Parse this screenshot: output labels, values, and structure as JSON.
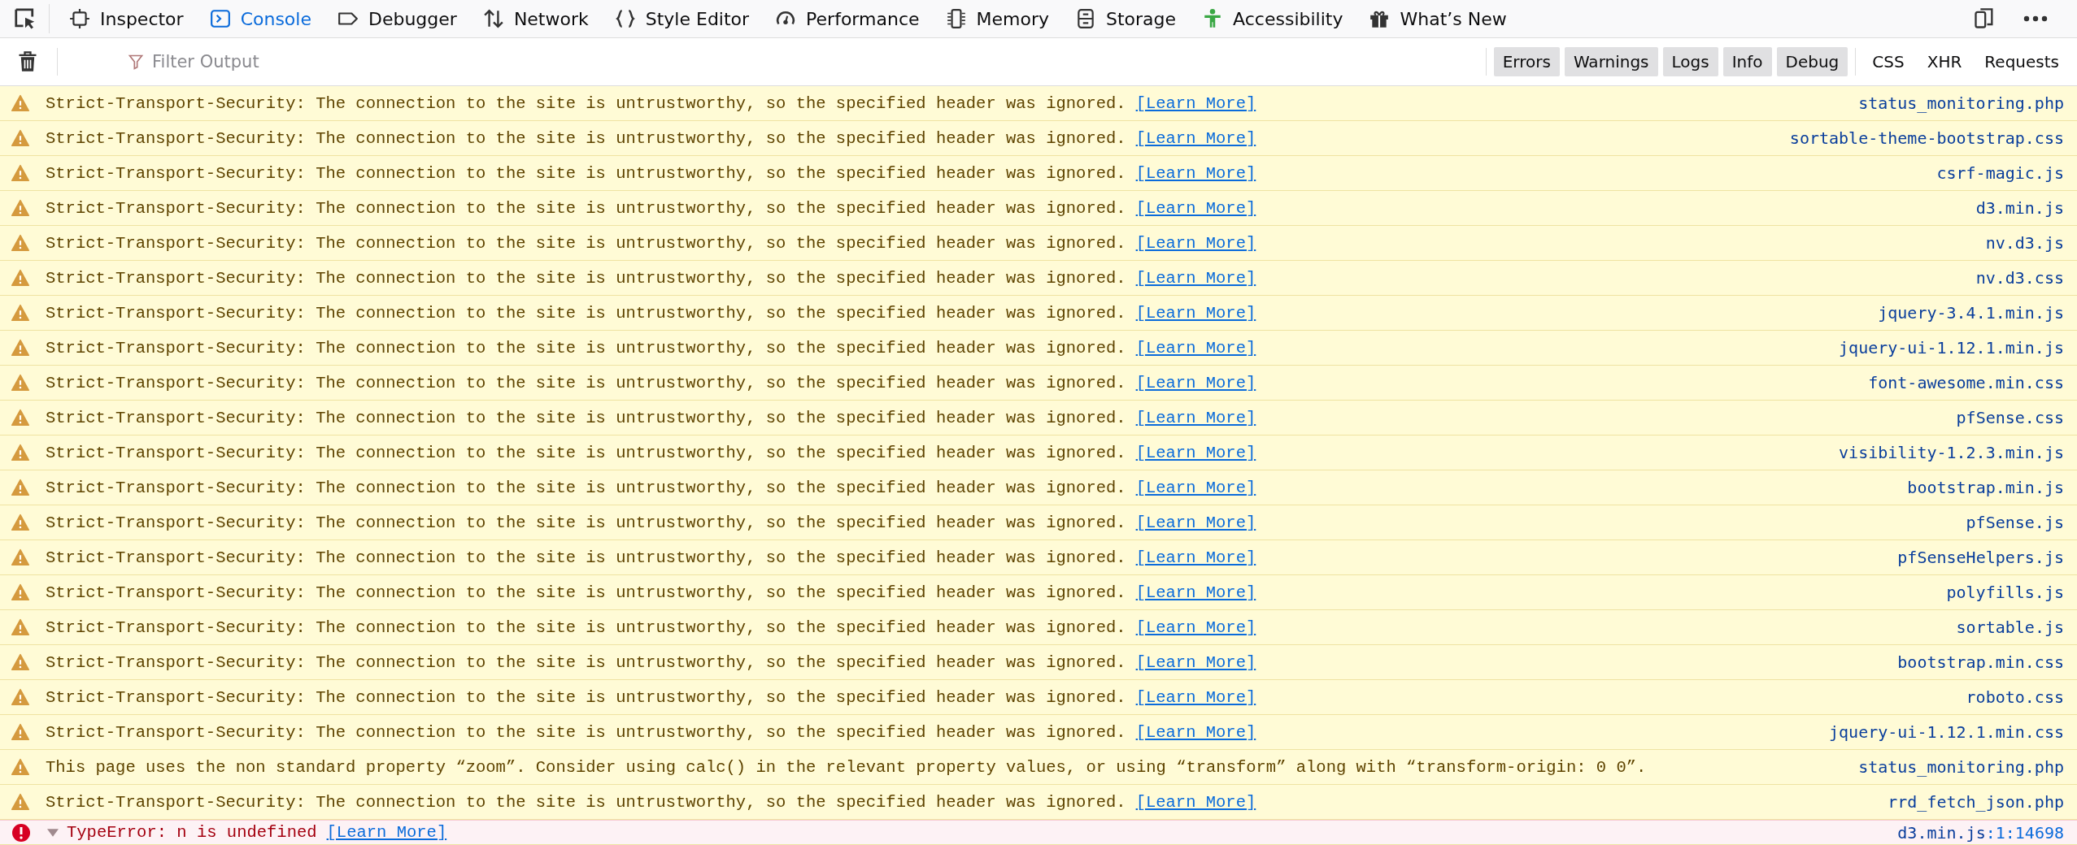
{
  "toolbar": {
    "tabs": [
      {
        "label": "Inspector",
        "selected": false
      },
      {
        "label": "Console",
        "selected": true
      },
      {
        "label": "Debugger",
        "selected": false
      },
      {
        "label": "Network",
        "selected": false
      },
      {
        "label": "Style Editor",
        "selected": false
      },
      {
        "label": "Performance",
        "selected": false
      },
      {
        "label": "Memory",
        "selected": false
      },
      {
        "label": "Storage",
        "selected": false
      },
      {
        "label": "Accessibility",
        "selected": false
      },
      {
        "label": "What’s New",
        "selected": false
      }
    ]
  },
  "filter_bar": {
    "placeholder": "Filter Output",
    "level_filters": [
      {
        "label": "Errors",
        "selected": true
      },
      {
        "label": "Warnings",
        "selected": true
      },
      {
        "label": "Logs",
        "selected": true
      },
      {
        "label": "Info",
        "selected": true
      },
      {
        "label": "Debug",
        "selected": true
      }
    ],
    "type_filters": [
      {
        "label": "CSS",
        "selected": false
      },
      {
        "label": "XHR",
        "selected": false
      },
      {
        "label": "Requests",
        "selected": false
      }
    ]
  },
  "messages": [
    {
      "kind": "warning",
      "text": "Strict-Transport-Security: The connection to the site is untrustworthy, so the specified header was ignored.",
      "link": "[Learn More]",
      "source": "status_monitoring.php"
    },
    {
      "kind": "warning",
      "text": "Strict-Transport-Security: The connection to the site is untrustworthy, so the specified header was ignored.",
      "link": "[Learn More]",
      "source": "sortable-theme-bootstrap.css"
    },
    {
      "kind": "warning",
      "text": "Strict-Transport-Security: The connection to the site is untrustworthy, so the specified header was ignored.",
      "link": "[Learn More]",
      "source": "csrf-magic.js"
    },
    {
      "kind": "warning",
      "text": "Strict-Transport-Security: The connection to the site is untrustworthy, so the specified header was ignored.",
      "link": "[Learn More]",
      "source": "d3.min.js"
    },
    {
      "kind": "warning",
      "text": "Strict-Transport-Security: The connection to the site is untrustworthy, so the specified header was ignored.",
      "link": "[Learn More]",
      "source": "nv.d3.js"
    },
    {
      "kind": "warning",
      "text": "Strict-Transport-Security: The connection to the site is untrustworthy, so the specified header was ignored.",
      "link": "[Learn More]",
      "source": "nv.d3.css"
    },
    {
      "kind": "warning",
      "text": "Strict-Transport-Security: The connection to the site is untrustworthy, so the specified header was ignored.",
      "link": "[Learn More]",
      "source": "jquery-3.4.1.min.js"
    },
    {
      "kind": "warning",
      "text": "Strict-Transport-Security: The connection to the site is untrustworthy, so the specified header was ignored.",
      "link": "[Learn More]",
      "source": "jquery-ui-1.12.1.min.js"
    },
    {
      "kind": "warning",
      "text": "Strict-Transport-Security: The connection to the site is untrustworthy, so the specified header was ignored.",
      "link": "[Learn More]",
      "source": "font-awesome.min.css"
    },
    {
      "kind": "warning",
      "text": "Strict-Transport-Security: The connection to the site is untrustworthy, so the specified header was ignored.",
      "link": "[Learn More]",
      "source": "pfSense.css"
    },
    {
      "kind": "warning",
      "text": "Strict-Transport-Security: The connection to the site is untrustworthy, so the specified header was ignored.",
      "link": "[Learn More]",
      "source": "visibility-1.2.3.min.js"
    },
    {
      "kind": "warning",
      "text": "Strict-Transport-Security: The connection to the site is untrustworthy, so the specified header was ignored.",
      "link": "[Learn More]",
      "source": "bootstrap.min.js"
    },
    {
      "kind": "warning",
      "text": "Strict-Transport-Security: The connection to the site is untrustworthy, so the specified header was ignored.",
      "link": "[Learn More]",
      "source": "pfSense.js"
    },
    {
      "kind": "warning",
      "text": "Strict-Transport-Security: The connection to the site is untrustworthy, so the specified header was ignored.",
      "link": "[Learn More]",
      "source": "pfSenseHelpers.js"
    },
    {
      "kind": "warning",
      "text": "Strict-Transport-Security: The connection to the site is untrustworthy, so the specified header was ignored.",
      "link": "[Learn More]",
      "source": "polyfills.js"
    },
    {
      "kind": "warning",
      "text": "Strict-Transport-Security: The connection to the site is untrustworthy, so the specified header was ignored.",
      "link": "[Learn More]",
      "source": "sortable.js"
    },
    {
      "kind": "warning",
      "text": "Strict-Transport-Security: The connection to the site is untrustworthy, so the specified header was ignored.",
      "link": "[Learn More]",
      "source": "bootstrap.min.css"
    },
    {
      "kind": "warning",
      "text": "Strict-Transport-Security: The connection to the site is untrustworthy, so the specified header was ignored.",
      "link": "[Learn More]",
      "source": "roboto.css"
    },
    {
      "kind": "warning",
      "text": "Strict-Transport-Security: The connection to the site is untrustworthy, so the specified header was ignored.",
      "link": "[Learn More]",
      "source": "jquery-ui-1.12.1.min.css"
    },
    {
      "kind": "warning",
      "text": "This page uses the non standard property “zoom”. Consider using calc() in the relevant property values, or using “transform” along with “transform-origin: 0 0”.",
      "source": "status_monitoring.php"
    },
    {
      "kind": "warning",
      "text": "Strict-Transport-Security: The connection to the site is untrustworthy, so the specified header was ignored.",
      "link": "[Learn More]",
      "source": "rrd_fetch_json.php"
    },
    {
      "kind": "error",
      "text": "TypeError: n is undefined",
      "link": "[Learn More]",
      "source": "d3.min.js",
      "location": ":1:14698"
    }
  ]
}
